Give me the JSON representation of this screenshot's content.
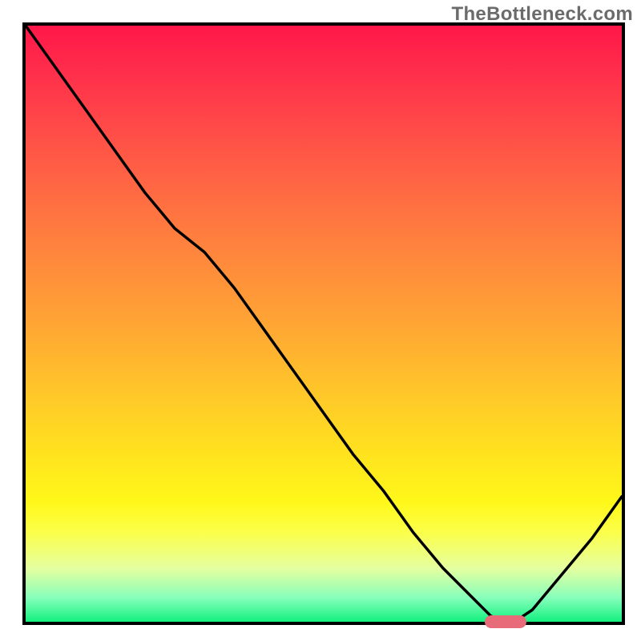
{
  "watermark_text": "TheBottleneck.com",
  "colors": {
    "curve": "#000000",
    "border": "#000000",
    "marker": "#e86b7a",
    "watermark": "#6b6b6b"
  },
  "chart_data": {
    "type": "line",
    "title": "",
    "xlabel": "",
    "ylabel": "",
    "xlim": [
      0,
      100
    ],
    "ylim": [
      0,
      100
    ],
    "grid": false,
    "legend": false,
    "series": [
      {
        "name": "bottleneck-curve",
        "color": "#000000",
        "x": [
          0,
          5,
          10,
          15,
          20,
          25,
          30,
          35,
          40,
          45,
          50,
          55,
          60,
          65,
          70,
          75,
          78,
          80,
          82,
          85,
          90,
          95,
          100
        ],
        "values": [
          100,
          93,
          86,
          79,
          72,
          66,
          62,
          56,
          49,
          42,
          35,
          28,
          22,
          15,
          9,
          4,
          1,
          0,
          0,
          2,
          8,
          14,
          21
        ]
      }
    ],
    "background_gradient": {
      "orientation": "vertical",
      "stops": [
        {
          "pos": 0.0,
          "color": "#ff1749"
        },
        {
          "pos": 0.08,
          "color": "#ff2f4b"
        },
        {
          "pos": 0.22,
          "color": "#ff5946"
        },
        {
          "pos": 0.36,
          "color": "#ff803e"
        },
        {
          "pos": 0.5,
          "color": "#ffa534"
        },
        {
          "pos": 0.62,
          "color": "#ffc829"
        },
        {
          "pos": 0.72,
          "color": "#ffe31e"
        },
        {
          "pos": 0.8,
          "color": "#fff81a"
        },
        {
          "pos": 0.85,
          "color": "#fbff4a"
        },
        {
          "pos": 0.91,
          "color": "#e6ffa0"
        },
        {
          "pos": 0.96,
          "color": "#86ffba"
        },
        {
          "pos": 1.0,
          "color": "#13f07f"
        }
      ]
    },
    "marker": {
      "x_start": 77,
      "x_end": 84,
      "y": 0
    }
  }
}
